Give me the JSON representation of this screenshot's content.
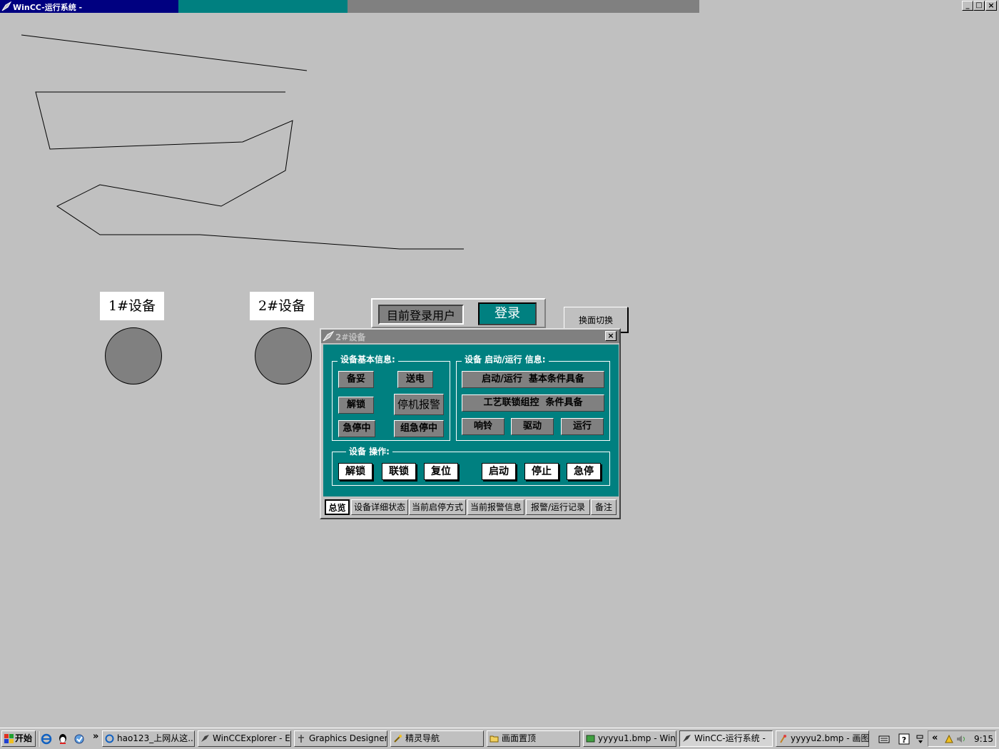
{
  "window": {
    "title": "WinCC-运行系统 -",
    "caption_buttons": [
      "_",
      "□",
      "×"
    ]
  },
  "devices": [
    {
      "label": "1#设备",
      "state_color": "#808080"
    },
    {
      "label": "2#设备",
      "state_color": "#808080"
    }
  ],
  "login": {
    "user_label": "目前登录用户",
    "login_button": "登录"
  },
  "switch_button": "换面切换",
  "popup": {
    "title": "2#设备",
    "close": "×",
    "basic_info": {
      "title": "设备基本信息:",
      "items": [
        "备妥",
        "送电",
        "解锁",
        "停机报警",
        "急停中",
        "组急停中"
      ]
    },
    "run_info": {
      "title": "设备 启动/运行 信息:",
      "rows": [
        "启动/运行  基本条件具备",
        "工艺联锁组控  条件具备"
      ],
      "items": [
        "响铃",
        "驱动",
        "运行"
      ]
    },
    "operation": {
      "title": "设备 操作:",
      "buttons": [
        "解锁",
        "联锁",
        "复位",
        "启动",
        "停止",
        "急停"
      ]
    },
    "tabs": [
      "总览",
      "设备详细状态",
      "当前启停方式",
      "当前报警信息",
      "报警/运行记录",
      "备注"
    ],
    "active_tab": "总览",
    "colors": {
      "panel": "#008080",
      "indicator": "#808080"
    }
  },
  "taskbar": {
    "start": "开始",
    "overflow": "»",
    "tasks": [
      {
        "label": "hao123_上网从这...",
        "icon": "ie-icon"
      },
      {
        "label": "WinCCExplorer - E:...",
        "icon": "wincc-explorer-icon"
      },
      {
        "label": "Graphics Designer ...",
        "icon": "graphics-designer-icon"
      },
      {
        "label": "精灵导航",
        "icon": "wizard-icon"
      },
      {
        "label": "画面置顶",
        "icon": "folder-icon"
      },
      {
        "label": "yyyyu1.bmp - Win...",
        "icon": "image-icon"
      },
      {
        "label": "WinCC-运行系统 -",
        "icon": "wincc-runtime-icon"
      },
      {
        "label": "yyyyu2.bmp - 画图",
        "icon": "paint-icon"
      }
    ],
    "tray_left": "«",
    "clock": "9:15"
  }
}
